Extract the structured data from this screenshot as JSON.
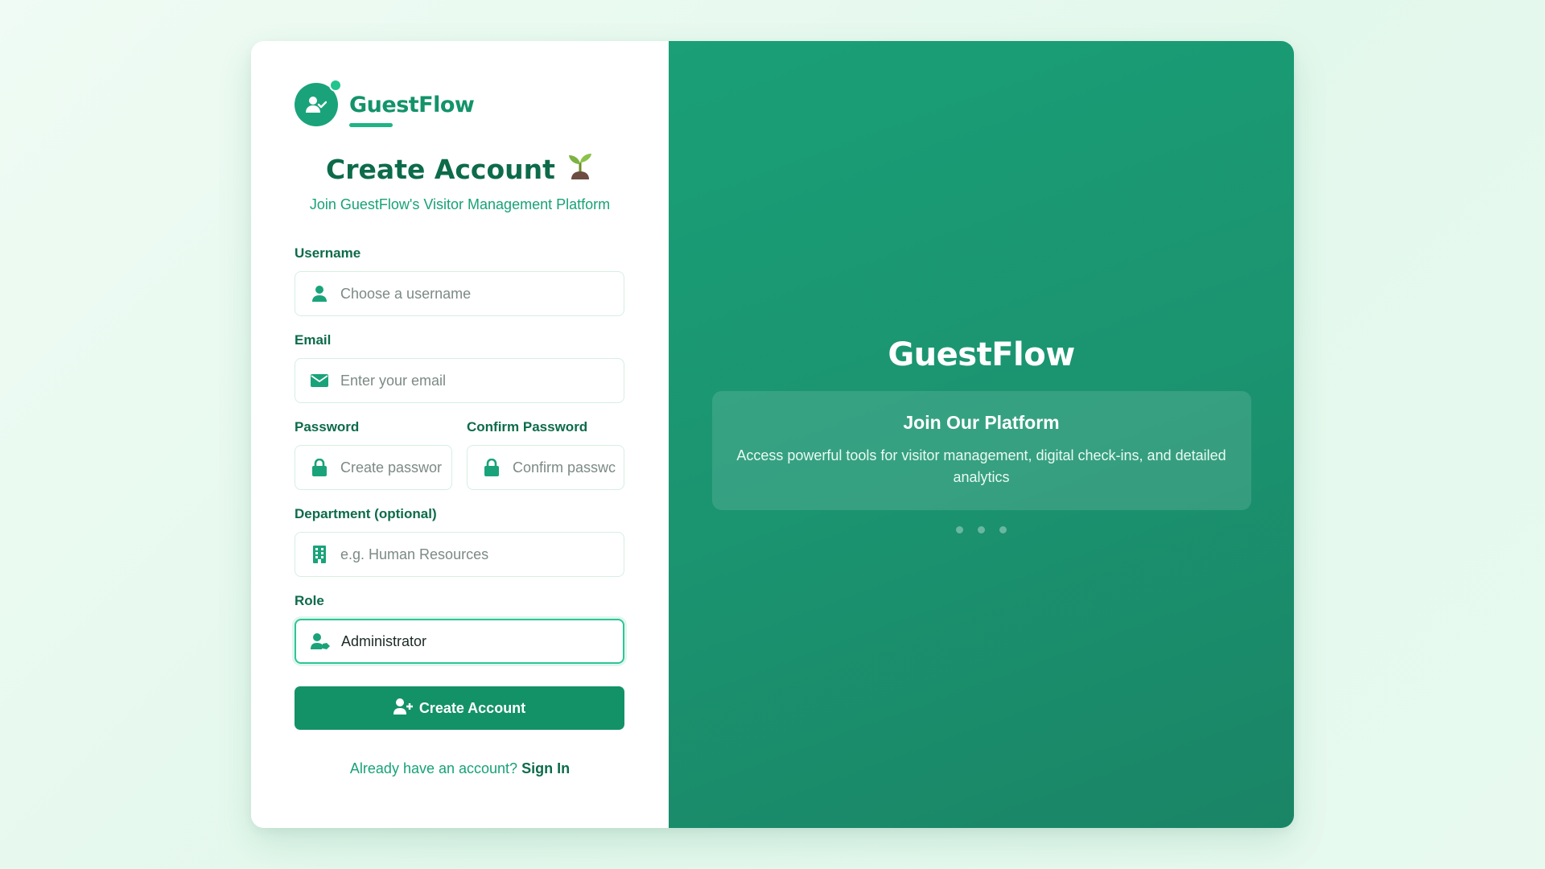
{
  "brand": {
    "name": "GuestFlow"
  },
  "heading": {
    "title": "Create Account",
    "emoji": "🌱",
    "subtitle": "Join GuestFlow's Visitor Management Platform"
  },
  "form": {
    "username": {
      "label": "Username",
      "placeholder": "Choose a username",
      "icon": "user-icon"
    },
    "email": {
      "label": "Email",
      "placeholder": "Enter your email",
      "icon": "envelope-icon"
    },
    "password": {
      "label": "Password",
      "placeholder": "Create passwor",
      "icon": "lock-icon"
    },
    "confirm_password": {
      "label": "Confirm Password",
      "placeholder": "Confirm passwc",
      "icon": "lock-icon"
    },
    "department": {
      "label": "Department (optional)",
      "placeholder": "e.g. Human Resources",
      "icon": "building-icon"
    },
    "role": {
      "label": "Role",
      "value": "Administrator",
      "icon": "user-tag-icon"
    },
    "submit_label": "Create Account",
    "signin_prompt": "Already have an account?",
    "signin_link": "Sign In"
  },
  "hero": {
    "title": "GuestFlow",
    "card_title": "Join Our Platform",
    "card_text": "Access powerful tools for visitor management, digital check-ins, and detailed analytics",
    "carousel_count": 3
  },
  "colors": {
    "primary": "#139267",
    "accent": "#1fb485",
    "panel": "#1a9f76"
  }
}
